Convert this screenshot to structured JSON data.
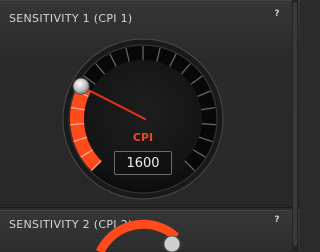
{
  "sections": [
    {
      "title": "SENSITIVITY 1 (CPI 1)",
      "help": "?",
      "dial": {
        "label": "CPI",
        "value": "1600",
        "level": 0.27,
        "accent": "#ff4a1c"
      }
    },
    {
      "title": "SENSITIVITY 2 (CPI 2)",
      "help": "?"
    }
  ],
  "colors": {
    "background": "#2b2b2b",
    "accent": "#ff4a1c",
    "label": "#e8482a",
    "text": "#d6d6d6"
  },
  "icons": [
    "help-icon",
    "dial-knob"
  ]
}
